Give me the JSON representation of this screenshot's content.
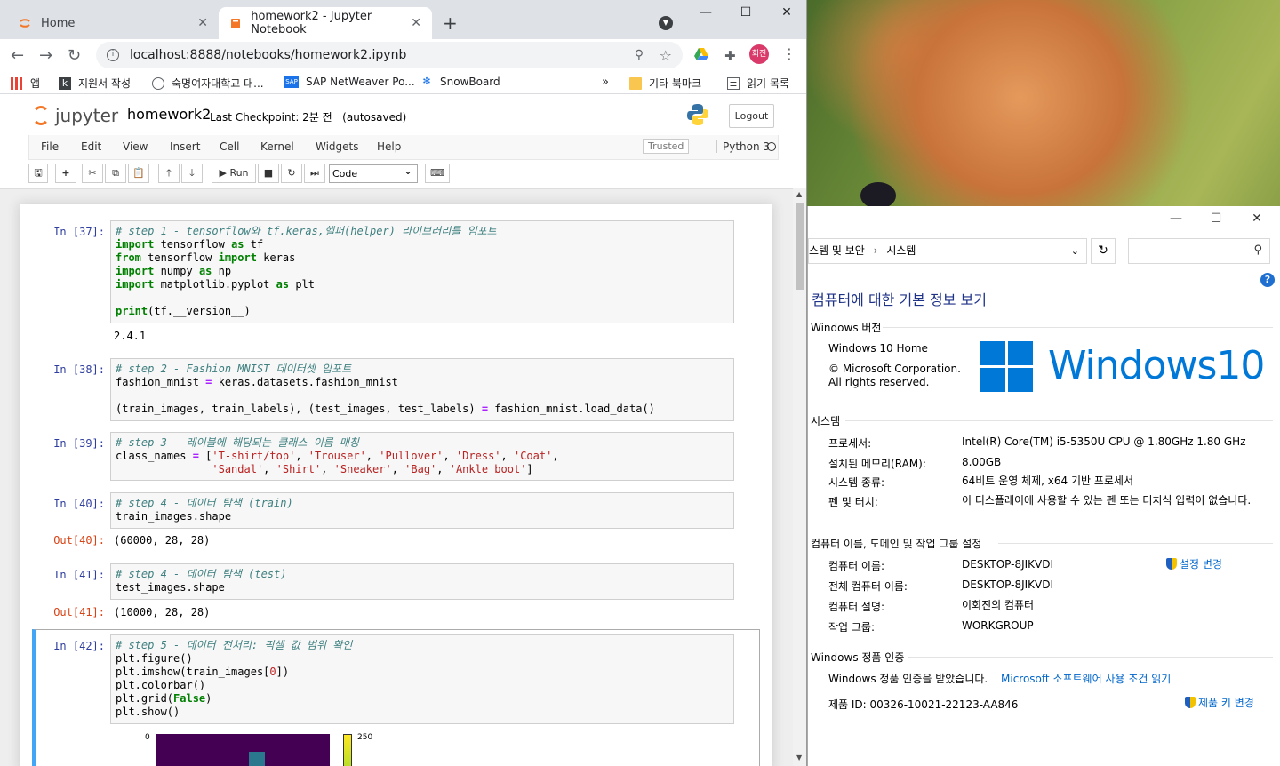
{
  "browser": {
    "tabs": [
      {
        "label": "Home"
      },
      {
        "label": "homework2 - Jupyter Notebook"
      }
    ],
    "url": "localhost:8888/notebooks/homework2.ipynb",
    "profile_label": "회진",
    "bookmarks": [
      {
        "label": "앱"
      },
      {
        "label": "지원서 작성"
      },
      {
        "label": "숙명여자대학교 대..."
      },
      {
        "label": "SAP NetWeaver Po..."
      },
      {
        "label": "SnowBoard"
      },
      {
        "label": "기타 북마크"
      },
      {
        "label": "읽기 목록"
      }
    ]
  },
  "jupyter": {
    "logo_text": "jupyter",
    "notebook_name": "homework2",
    "checkpoint": "Last Checkpoint: 2분 전",
    "autosave": "(autosaved)",
    "logout_label": "Logout",
    "menu": [
      "File",
      "Edit",
      "View",
      "Insert",
      "Cell",
      "Kernel",
      "Widgets",
      "Help"
    ],
    "trusted_label": "Trusted",
    "kernel_name": "Python 3",
    "run_label": "Run",
    "cell_type": "Code",
    "cells": [
      {
        "prompt": "In [37]:",
        "output_prompt": "",
        "output": "2.4.1"
      },
      {
        "prompt": "In [38]:",
        "output_prompt": "",
        "output": ""
      },
      {
        "prompt": "In [39]:",
        "output_prompt": "",
        "output": ""
      },
      {
        "prompt": "In [40]:",
        "output_prompt": "Out[40]:",
        "output": "(60000, 28, 28)"
      },
      {
        "prompt": "In [41]:",
        "output_prompt": "Out[41]:",
        "output": "(10000, 28, 28)"
      },
      {
        "prompt": "In [42]:",
        "output_prompt": "",
        "output": ""
      }
    ],
    "plot_axis": {
      "y_tick": "0",
      "colorbar_tick": "250"
    }
  },
  "system_window": {
    "breadcrumb": [
      "스템 및 보안",
      "시스템"
    ],
    "heading": "컴퓨터에 대한 기본 정보 보기",
    "edition_section": "Windows 버전",
    "edition": "Windows 10 Home",
    "copyright": "© Microsoft Corporation.",
    "rights": "All rights reserved.",
    "logo_text": "Windows",
    "logo_version": "10",
    "system_section": "시스템",
    "system_rows": [
      {
        "label": "프로세서:",
        "value": "Intel(R) Core(TM) i5-5350U CPU @ 1.80GHz   1.80 GHz"
      },
      {
        "label": "설치된 메모리(RAM):",
        "value": "8.00GB"
      },
      {
        "label": "시스템 종류:",
        "value": "64비트 운영 체제, x64 기반 프로세서"
      },
      {
        "label": "펜 및 터치:",
        "value": "이 디스플레이에 사용할 수 있는 펜 또는 터치식 입력이 없습니다."
      }
    ],
    "computer_section": "컴퓨터 이름, 도메인 및 작업 그룹 설정",
    "computer_rows": [
      {
        "label": "컴퓨터 이름:",
        "value": "DESKTOP-8JIKVDI"
      },
      {
        "label": "전체 컴퓨터 이름:",
        "value": "DESKTOP-8JIKVDI"
      },
      {
        "label": "컴퓨터 설명:",
        "value": "이회진의 컴퓨터"
      },
      {
        "label": "작업 그룹:",
        "value": "WORKGROUP"
      }
    ],
    "change_settings": "설정 변경",
    "activation_section": "Windows 정품 인증",
    "activation_status": "Windows 정품 인증을 받았습니다.",
    "license_link": "Microsoft 소프트웨어 사용 조건 읽기",
    "product_id": "제품 ID: 00326-10021-22123-AA846",
    "change_key": "제품 키 변경"
  }
}
